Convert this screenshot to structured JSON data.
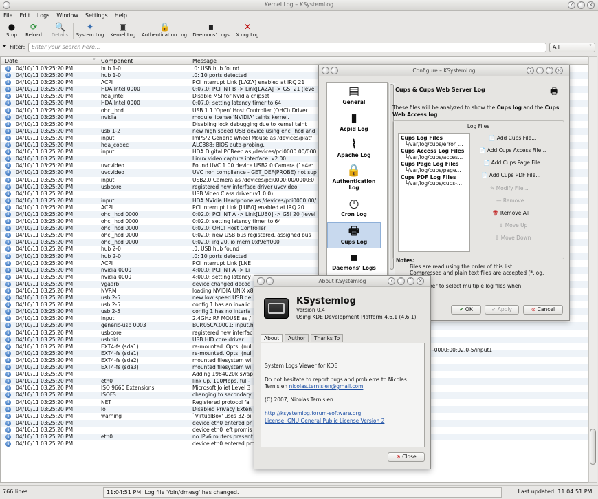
{
  "window": {
    "title": "Kernel Log – KSystemLog"
  },
  "menu": [
    "File",
    "Edit",
    "Logs",
    "Window",
    "Settings",
    "Help"
  ],
  "toolbar": {
    "stop": "Stop",
    "reload": "Reload",
    "details": "Details",
    "system_log": "System Log",
    "kernel_log": "Kernel Log",
    "auth_log": "Authentication Log",
    "daemons_logs": "Daemons' Logs",
    "xorg_log": "X.org Log"
  },
  "filter": {
    "label": "Filter:",
    "placeholder": "Enter your search here...",
    "select": "All"
  },
  "table": {
    "headers": {
      "date": "Date",
      "component": "Component",
      "message": "Message"
    },
    "rows": [
      [
        "04/10/11 03:25:20 PM",
        "hub 1-0",
        ".0: USB hub found"
      ],
      [
        "04/10/11 03:25:20 PM",
        "hub 1-0",
        ".0: 10 ports detected"
      ],
      [
        "04/10/11 03:25:20 PM",
        "ACPI",
        "PCI Interrupt Link [LAZA] enabled at IRQ 21"
      ],
      [
        "04/10/11 03:25:20 PM",
        "HDA Intel 0000",
        "0:07.0: PCI INT B -> Link[LAZA] -> GSI 21 (level"
      ],
      [
        "04/10/11 03:25:20 PM",
        "hda_intel",
        "Disable MSI for Nvidia chipset"
      ],
      [
        "04/10/11 03:25:20 PM",
        "HDA Intel 0000",
        "0:07.0: setting latency timer to 64"
      ],
      [
        "04/10/11 03:25:20 PM",
        "ohci_hcd",
        "USB 1.1 'Open' Host Controller (OHCI) Driver"
      ],
      [
        "04/10/11 03:25:20 PM",
        "nvidia",
        "module license 'NVIDIA' taints kernel."
      ],
      [
        "04/10/11 03:25:20 PM",
        "",
        "Disabling lock debugging due to kernel taint"
      ],
      [
        "04/10/11 03:25:20 PM",
        "usb 1-2",
        "new high speed USB device using ehci_hcd and"
      ],
      [
        "04/10/11 03:25:20 PM",
        "input",
        "ImPS/2 Generic Wheel Mouse as /devices/platf"
      ],
      [
        "04/10/11 03:25:20 PM",
        "hda_codec",
        "ALC888: BIOS auto-probing."
      ],
      [
        "04/10/11 03:25:20 PM",
        "input",
        "HDA Digital PCBeep as /devices/pci0000:00/000"
      ],
      [
        "04/10/11 03:25:20 PM",
        "",
        "Linux video capture interface: v2.00"
      ],
      [
        "04/10/11 03:25:20 PM",
        "uvcvideo",
        "Found UVC 1.00 device USB2.0 Camera (1e4e:"
      ],
      [
        "04/10/11 03:25:20 PM",
        "uvcvideo",
        "UVC non compliance - GET_DEF(PROBE) not sup"
      ],
      [
        "04/10/11 03:25:20 PM",
        "input",
        "USB2.0 Camera as /devices/pci0000:00/0000:0"
      ],
      [
        "04/10/11 03:25:20 PM",
        "usbcore",
        "registered new interface driver uvcvideo"
      ],
      [
        "04/10/11 03:25:20 PM",
        "",
        "USB Video Class driver (v1.0.0)"
      ],
      [
        "04/10/11 03:25:20 PM",
        "input",
        "HDA NVidia Headphone as /devices/pci0000:00/"
      ],
      [
        "04/10/11 03:25:20 PM",
        "ACPI",
        "PCI Interrupt Link [LUB0] enabled at IRQ 20"
      ],
      [
        "04/10/11 03:25:20 PM",
        "ohci_hcd 0000",
        "0:02.0: PCI INT A -> Link[LUB0] -> GSI 20 (level"
      ],
      [
        "04/10/11 03:25:20 PM",
        "ohci_hcd 0000",
        "0:02.0: setting latency timer to 64"
      ],
      [
        "04/10/11 03:25:20 PM",
        "ohci_hcd 0000",
        "0:02.0: OHCI Host Controller"
      ],
      [
        "04/10/11 03:25:20 PM",
        "ohci_hcd 0000",
        "0:02.0: new USB bus registered, assigned bus"
      ],
      [
        "04/10/11 03:25:20 PM",
        "ohci_hcd 0000",
        "0:02.0: irq 20, io mem 0xf9eff000"
      ],
      [
        "04/10/11 03:25:20 PM",
        "hub 2-0",
        ".0: USB hub found"
      ],
      [
        "04/10/11 03:25:20 PM",
        "hub 2-0",
        ".0: 10 ports detected"
      ],
      [
        "04/10/11 03:25:20 PM",
        "ACPI",
        "PCI Interrupt Link [LNE"
      ],
      [
        "04/10/11 03:25:20 PM",
        "nvidia 0000",
        "4:00.0: PCI INT A -> Li"
      ],
      [
        "04/10/11 03:25:20 PM",
        "nvidia 0000",
        "4:00.0: setting latency"
      ],
      [
        "04/10/11 03:25:20 PM",
        "vgaarb",
        "device changed decod"
      ],
      [
        "04/10/11 03:25:20 PM",
        "NVRM",
        "loading NVIDIA UNIX x8"
      ],
      [
        "04/10/11 03:25:20 PM",
        "usb 2-5",
        "new low speed USB de"
      ],
      [
        "04/10/11 03:25:20 PM",
        "usb 2-5",
        "config 1 has an invalid"
      ],
      [
        "04/10/11 03:25:20 PM",
        "usb 2-5",
        "config 1 has no interfa"
      ],
      [
        "04/10/11 03:25:20 PM",
        "input",
        "2.4GHz RF MOUSE as /"
      ],
      [
        "04/10/11 03:25:20 PM",
        "generic-usb 0003",
        "BCP.05CA.0001: input.h"
      ],
      [
        "04/10/11 03:25:20 PM",
        "usbcore",
        "registered new interfac"
      ],
      [
        "04/10/11 03:25:20 PM",
        "usbhid",
        "USB HID core driver"
      ],
      [
        "04/10/11 03:25:20 PM",
        "EXT4-fs (sda1)",
        "re-mounted. Opts: (nul"
      ],
      [
        "04/10/11 03:25:20 PM",
        "EXT4-fs (sda1)",
        "re-mounted. Opts: (nul"
      ],
      [
        "04/10/11 03:25:20 PM",
        "EXT4-fs (sda2)",
        "mounted filesystem wi"
      ],
      [
        "04/10/11 03:25:20 PM",
        "EXT4-fs (sda3)",
        "mounted filesystem wi"
      ],
      [
        "04/10/11 03:25:20 PM",
        "",
        "Adding 1984020k swap"
      ],
      [
        "04/10/11 03:25:20 PM",
        "eth0",
        "link up, 100Mbps, full-"
      ],
      [
        "04/10/11 03:25:20 PM",
        "ISO 9660 Extensions",
        "Microsoft Joliet Level 3"
      ],
      [
        "04/10/11 03:25:20 PM",
        "ISOFS",
        "changing to secondary"
      ],
      [
        "04/10/11 03:25:20 PM",
        "NET",
        "Registered protocol fa"
      ],
      [
        "04/10/11 03:25:20 PM",
        "lo",
        "Disabled Privacy Exten"
      ],
      [
        "04/10/11 03:25:20 PM",
        "warning",
        "`VirtualBox' uses 32-bi"
      ],
      [
        "04/10/11 03:25:20 PM",
        "",
        "device eth0 entered pr"
      ],
      [
        "04/10/11 03:25:20 PM",
        "",
        "device eth0 left promis"
      ],
      [
        "04/10/11 03:25:20 PM",
        "eth0",
        "no IPv6 routers present"
      ],
      [
        "04/10/11 03:25:20 PM",
        "",
        "device eth0 entered promiscuous mode"
      ]
    ],
    "overflow_text": "-0000:00:02.0-5/input1"
  },
  "status": {
    "lines": "766 lines.",
    "message": "11:04:51 PM: Log file '/bin/dmesg' has changed.",
    "updated": "Last updated: 11:04:51 PM."
  },
  "configure": {
    "title": "Configure – KSystemLog",
    "side": [
      "General",
      "Acpid Log",
      "Apache Log",
      "Authentication Log",
      "Cron Log",
      "Cups Log",
      "Daemons' Logs"
    ],
    "heading": "Cups & Cups Web Server Log",
    "desc1": "These files will be analyzed to show the",
    "desc_b1": "Cups log",
    "desc2": "and the",
    "desc_b2": "Cups Web Access log",
    "desc3": ".",
    "group": "Log Files",
    "files": [
      "Cups Log Files",
      "/var/log/cups/error_...",
      "Cups Access Log Files",
      "/var/log/cups/acces...",
      "Cups Page Log Files",
      "/var/log/cups/page...",
      "Cups PDF Log Files",
      "/var/log/cups/cups-..."
    ],
    "actions": [
      "Add Cups File...",
      "Add Cups Access File...",
      "Add Cups Page File...",
      "Add Cups PDF File...",
      "Modify File...",
      "Remove",
      "Remove All",
      "Move Up",
      "Move Down"
    ],
    "notes_label": "Notes:",
    "notes": [
      "Files are read using the order of this list.",
      "Compressed and plain text files are accepted (*.log,",
      "bz2,...).",
      "he '*' joker to select multiple log files when",
      "g files."
    ],
    "ok": "OK",
    "apply": "Apply",
    "cancel": "Cancel"
  },
  "about": {
    "title": "About KSystemlog",
    "app": "KSystemlog",
    "version": "Version 0.4",
    "platform": "Using KDE Development Platform 4.6.1 (4.6.1)",
    "tabs": [
      "About",
      "Author",
      "Thanks To"
    ],
    "desc": "System Logs Viewer for KDE",
    "bugs1": "Do not hesitate to report bugs and problems to Nicolas",
    "bugs2": "Ternisien",
    "email": "nicolas.ternisien@gmail.com",
    "copyright": "(C) 2007, Nicolas Ternisien",
    "url": "http://ksystemlog.forum-software.org",
    "license": "License: GNU General Public License Version 2",
    "close": "Close"
  }
}
